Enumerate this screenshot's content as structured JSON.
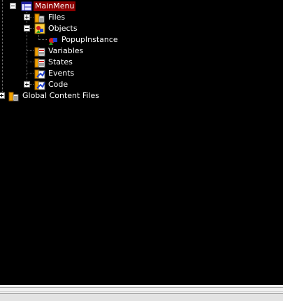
{
  "tree": {
    "root": {
      "label": "MainMenu",
      "expanded": true,
      "selected": true,
      "icon": "screen-icon"
    },
    "children": [
      {
        "label": "Files",
        "icon": "file-folder-icon",
        "expander": "plus"
      },
      {
        "label": "Objects",
        "icon": "objects-icon",
        "expander": "minus",
        "children": [
          {
            "label": "PopupInstance",
            "icon": "instance-icon"
          }
        ]
      },
      {
        "label": "Variables",
        "icon": "variables-icon"
      },
      {
        "label": "States",
        "icon": "states-icon"
      },
      {
        "label": "Events",
        "icon": "events-icon"
      },
      {
        "label": "Code",
        "icon": "code-icon",
        "expander": "plus"
      }
    ],
    "global": {
      "label": "Global Content Files",
      "icon": "file-folder-icon",
      "expander": "plus"
    }
  },
  "colors": {
    "panel_bg": "#000000",
    "text": "#ffffff",
    "selection_bg": "#8b0000"
  }
}
